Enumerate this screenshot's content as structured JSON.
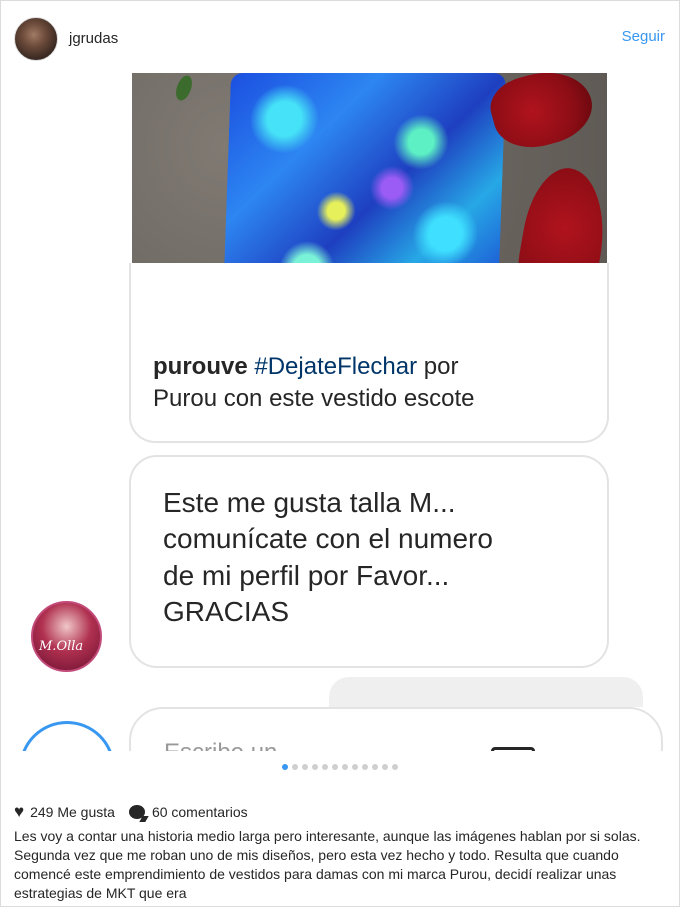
{
  "header": {
    "username": "jgrudas",
    "follow_label": "Seguir"
  },
  "caption": {
    "user": "purouve",
    "hashtag": "#DejateFlechar",
    "text_after_tag": " por",
    "line2": "Purou con este vestido escote"
  },
  "message": {
    "lines": [
      "Este me gusta talla M...",
      "comunícate con el numero",
      "de mi perfil por Favor...",
      "GRACIAS"
    ]
  },
  "input": {
    "placeholder": "Escribe un..."
  },
  "carousel": {
    "total": 12,
    "active_index": 0
  },
  "stats": {
    "likes": "249 Me gusta",
    "comments": "60 comentarios"
  },
  "description": "Les voy a contar una historia medio larga pero interesante, aunque las imágenes hablan por si solas. Segunda vez que me roban uno de mis diseños, pero esta vez hecho y todo. Resulta que cuando comencé este emprendimiento de vestidos para damas con mi marca Purou, decidí realizar unas estrategias de MKT que era"
}
